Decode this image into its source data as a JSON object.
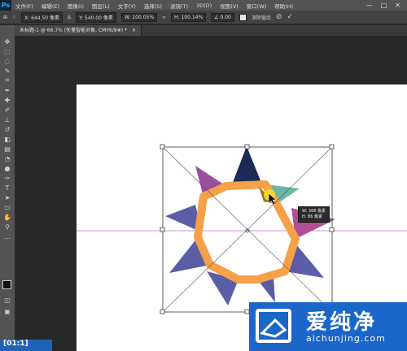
{
  "app": {
    "logo": "Ps"
  },
  "menubar": {
    "items": [
      {
        "label": "文件(F)"
      },
      {
        "label": "编辑(E)"
      },
      {
        "label": "图像(I)"
      },
      {
        "label": "图层(L)"
      },
      {
        "label": "文字(Y)"
      },
      {
        "label": "选择(S)"
      },
      {
        "label": "滤镜(T)"
      },
      {
        "label": "3D(D)"
      },
      {
        "label": "视图(V)"
      },
      {
        "label": "窗口(W)"
      },
      {
        "label": "帮助(H)"
      }
    ],
    "min": "—",
    "max": "□",
    "close": "✕"
  },
  "options": {
    "x": "X: 644.50 像素",
    "delta": "Δ",
    "y": "Y: 540.00 像素",
    "w": "W: 100.05%",
    "link": "∞",
    "h": "H: 100.14%",
    "angle": "∠ 0.00",
    "antialias": "消除锯齿",
    "cancel": "⊘",
    "commit": "✓"
  },
  "doc_tab": {
    "label": "未标题-1 @ 66.7% (矢量智能对象, CMYK/8#) *",
    "close": "×"
  },
  "tooltip": {
    "line1": "W: 368 像素",
    "line2": "H: 86 像素"
  },
  "watermark": {
    "chinese": "爱纯净",
    "url": "aichunjing.com"
  },
  "corner_tag": "[01:1]",
  "colors": {
    "navy": "#1c2b55",
    "purple": "#9a4f9f",
    "orange": "#f4a147",
    "periwinkle": "#5b5ea6",
    "mauve": "#b04f95",
    "teal": "#6ab7a8",
    "brown": "#a36a21",
    "cursor": "#f5e020"
  }
}
